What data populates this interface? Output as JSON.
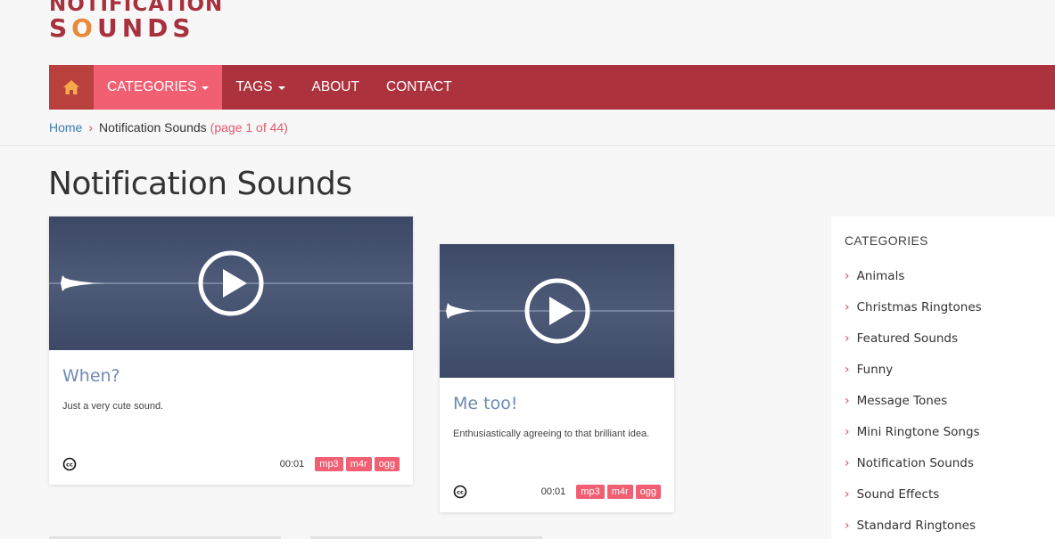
{
  "logo": {
    "line1": "NOTIFICATION",
    "line2_pre": "S",
    "line2_o": "O",
    "line2_post": "UNDS"
  },
  "nav": {
    "home_icon": "home-icon",
    "items": [
      {
        "label": "CATEGORIES",
        "dropdown": true,
        "active": true
      },
      {
        "label": "TAGS",
        "dropdown": true,
        "active": false
      },
      {
        "label": "ABOUT",
        "dropdown": false,
        "active": false
      },
      {
        "label": "CONTACT",
        "dropdown": false,
        "active": false
      }
    ]
  },
  "breadcrumb": {
    "home": "Home",
    "current": "Notification Sounds",
    "page": "(page 1 of 44)"
  },
  "page_title": "Notification Sounds",
  "cards": [
    {
      "title": "When?",
      "description": "Just a very cute sound.",
      "duration": "00:01",
      "formats": [
        "mp3",
        "m4r",
        "ogg"
      ]
    },
    {
      "title": "Me too!",
      "description": "Enthusiastically agreeing to that brilliant idea.",
      "duration": "00:01",
      "formats": [
        "mp3",
        "m4r",
        "ogg"
      ]
    }
  ],
  "sidebar": {
    "heading": "CATEGORIES",
    "items": [
      "Animals",
      "Christmas Ringtones",
      "Featured Sounds",
      "Funny",
      "Message Tones",
      "Mini Ringtone Songs",
      "Notification Sounds",
      "Sound Effects",
      "Standard Ringtones"
    ]
  },
  "colors": {
    "brand": "#ac323e",
    "accent": "#f05f72",
    "player_bg": "#414d6b",
    "link": "#3f7ab0"
  }
}
